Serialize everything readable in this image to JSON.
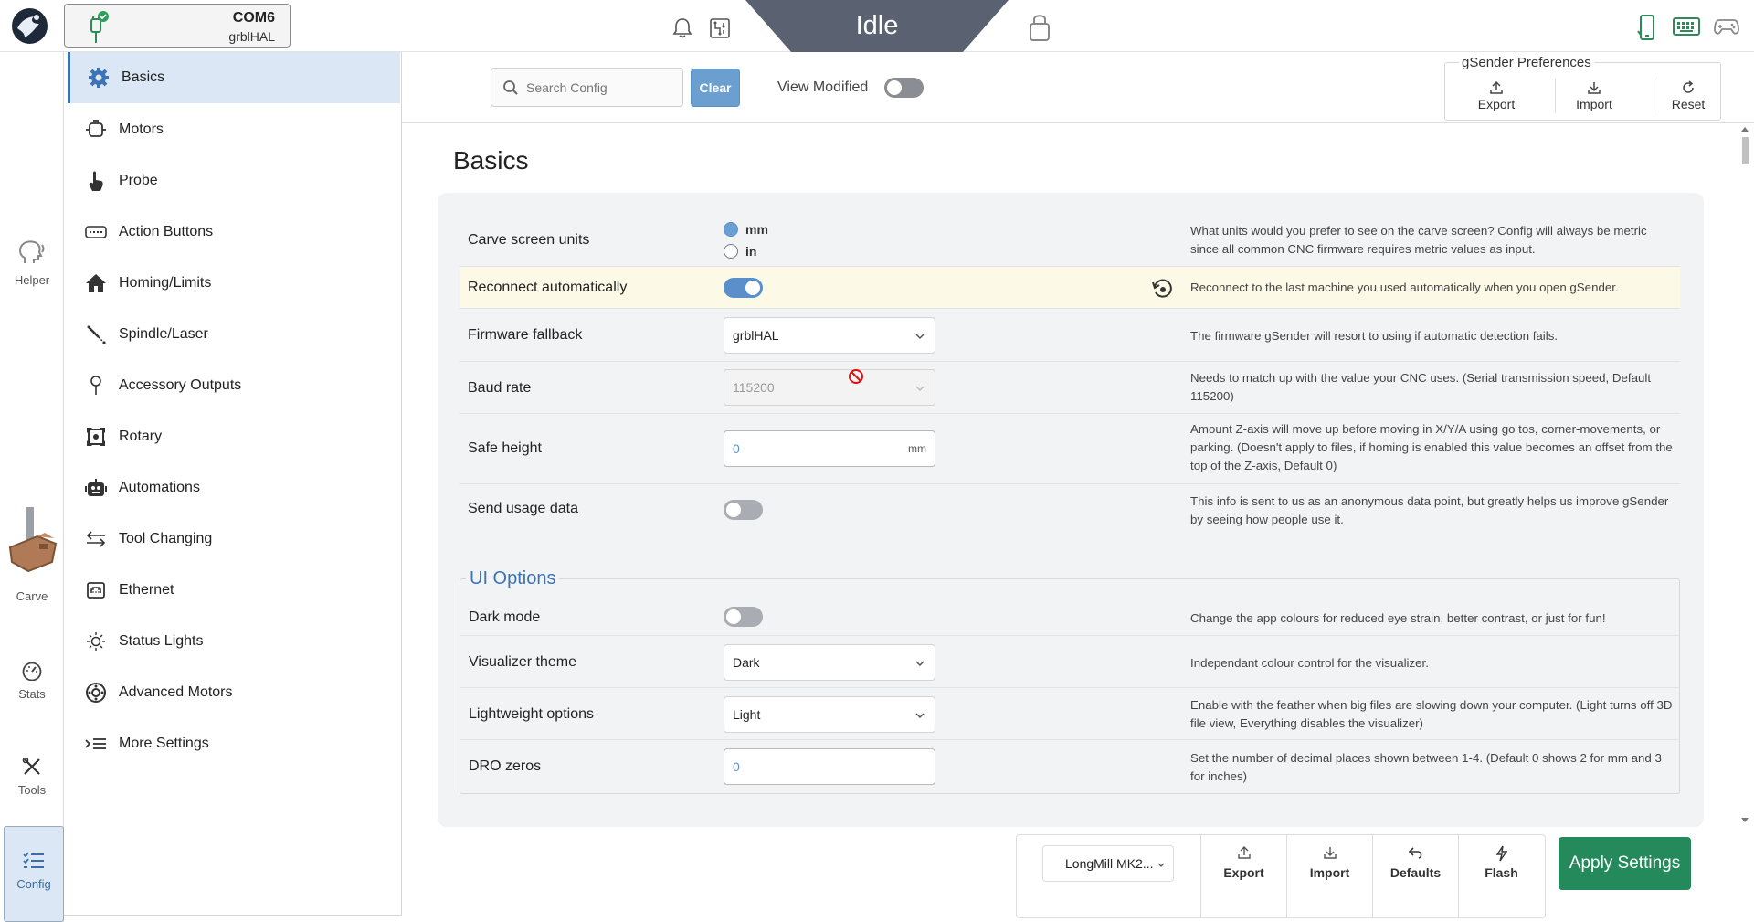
{
  "topbar": {
    "port": "COM6",
    "firmware": "grblHAL",
    "status": "Idle"
  },
  "leftnav": {
    "helper": "Helper",
    "carve": "Carve",
    "stats": "Stats",
    "tools": "Tools",
    "config": "Config"
  },
  "categories": [
    {
      "label": "Basics",
      "icon": "gear-icon"
    },
    {
      "label": "Motors",
      "icon": "motor-icon"
    },
    {
      "label": "Probe",
      "icon": "hand-pointer-icon"
    },
    {
      "label": "Action Buttons",
      "icon": "keyboard-icon"
    },
    {
      "label": "Homing/Limits",
      "icon": "home-icon"
    },
    {
      "label": "Spindle/Laser",
      "icon": "spindle-icon"
    },
    {
      "label": "Accessory Outputs",
      "icon": "pin-icon"
    },
    {
      "label": "Rotary",
      "icon": "rotary-icon"
    },
    {
      "label": "Automations",
      "icon": "robot-icon"
    },
    {
      "label": "Tool Changing",
      "icon": "swap-arrows-icon"
    },
    {
      "label": "Ethernet",
      "icon": "ethernet-icon"
    },
    {
      "label": "Status Lights",
      "icon": "sun-icon"
    },
    {
      "label": "Advanced Motors",
      "icon": "advanced-motor-icon"
    },
    {
      "label": "More Settings",
      "icon": "list-indent-icon"
    }
  ],
  "header": {
    "search_placeholder": "Search Config",
    "clear_label": "Clear",
    "view_modified_label": "View Modified",
    "prefs_title": "gSender Preferences",
    "prefs_export": "Export",
    "prefs_import": "Import",
    "prefs_reset": "Reset"
  },
  "page": {
    "title": "Basics"
  },
  "settings": {
    "units": {
      "label": "Carve screen units",
      "option_mm": "mm",
      "option_in": "in",
      "desc": "What units would you prefer to see on the carve screen? Config will always be metric since all common CNC firmware requires metric values as input."
    },
    "reconnect": {
      "label": "Reconnect automatically",
      "desc": "Reconnect to the last machine you used automatically when you open gSender."
    },
    "fallback": {
      "label": "Firmware fallback",
      "value": "grblHAL",
      "desc": "The firmware gSender will resort to using if automatic detection fails."
    },
    "baud": {
      "label": "Baud rate",
      "value": "115200",
      "desc": "Needs to match up with the value your CNC uses. (Serial transmission speed, Default 115200)"
    },
    "safe_height": {
      "label": "Safe height",
      "value": "0",
      "unit": "mm",
      "desc": "Amount Z-axis will move up before moving in X/Y/A using go tos, corner-movements, or parking. (Doesn't apply to files, if homing is enabled this value becomes an offset from the top of the Z-axis, Default 0)"
    },
    "usage": {
      "label": "Send usage data",
      "desc": "This info is sent to us as an anonymous data point, but greatly helps us improve gSender by seeing how people use it."
    }
  },
  "ui_options": {
    "legend": "UI Options",
    "dark_mode": {
      "label": "Dark mode",
      "desc": "Change the app colours for reduced eye strain, better contrast, or just for fun!"
    },
    "visualizer": {
      "label": "Visualizer theme",
      "value": "Dark",
      "desc": "Independant colour control for the visualizer."
    },
    "lightweight": {
      "label": "Lightweight options",
      "value": "Light",
      "desc": "Enable with the feather when big files are slowing down your computer. (Light turns off 3D file view, Everything disables the visualizer)"
    },
    "dro": {
      "label": "DRO zeros",
      "value": "0",
      "desc": "Set the number of decimal places shown between 1-4. (Default 0 shows 2 for mm and 3 for inches)"
    }
  },
  "bottom": {
    "machine": "LongMill MK2...",
    "export": "Export",
    "import": "Import",
    "defaults": "Defaults",
    "flash": "Flash",
    "apply": "Apply Settings"
  },
  "colors": {
    "accent": "#3a73b6",
    "status_banner": "#5a6271",
    "apply_green": "#248a5c",
    "highlight_row": "#fcf9e6"
  }
}
